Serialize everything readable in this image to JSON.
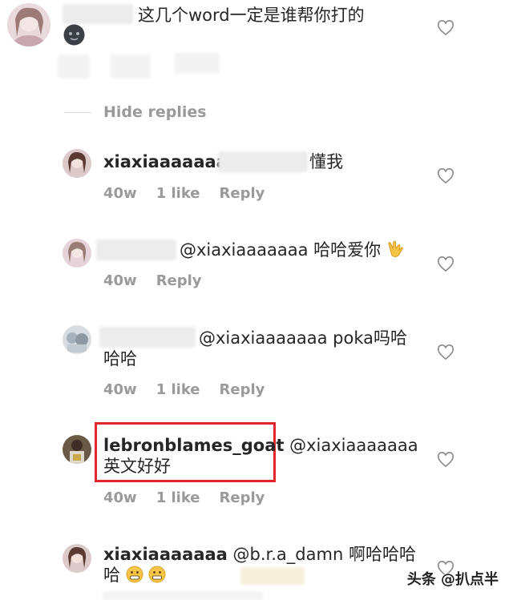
{
  "comment_top": {
    "text": "这几个word一定是谁帮你打的"
  },
  "hide_replies": "Hide replies",
  "replies": [
    {
      "username": "xiaxiaaaaaaa",
      "text": "懂我",
      "time": "40w",
      "likes": "1 like",
      "reply": "Reply"
    },
    {
      "mention": "@xiaxiaaaaaaa",
      "text": "哈哈爱你",
      "time": "40w",
      "reply": "Reply"
    },
    {
      "mention": "@xiaxiaaaaaaa",
      "text": "poka吗哈",
      "text2": "哈哈",
      "time": "40w",
      "likes": "1 like",
      "reply": "Reply"
    },
    {
      "username": "lebronblames_goat",
      "mention": "@xiaxiaaaaaaa",
      "text2": "英文好好",
      "time": "40w",
      "likes": "1 like",
      "reply": "Reply"
    },
    {
      "username": "xiaxiaaaaaaa",
      "mention": "@b.r.a_damn",
      "text": "啊哈哈哈",
      "text2": "哈"
    }
  ],
  "watermark": "头条 @扒点半",
  "colors": {
    "highlight": "#e3252c",
    "meta": "#9a9a9a",
    "text": "#262626"
  },
  "icons": [
    "heart-outline-icon",
    "hand-sign-emoji",
    "grimace-emoji"
  ]
}
